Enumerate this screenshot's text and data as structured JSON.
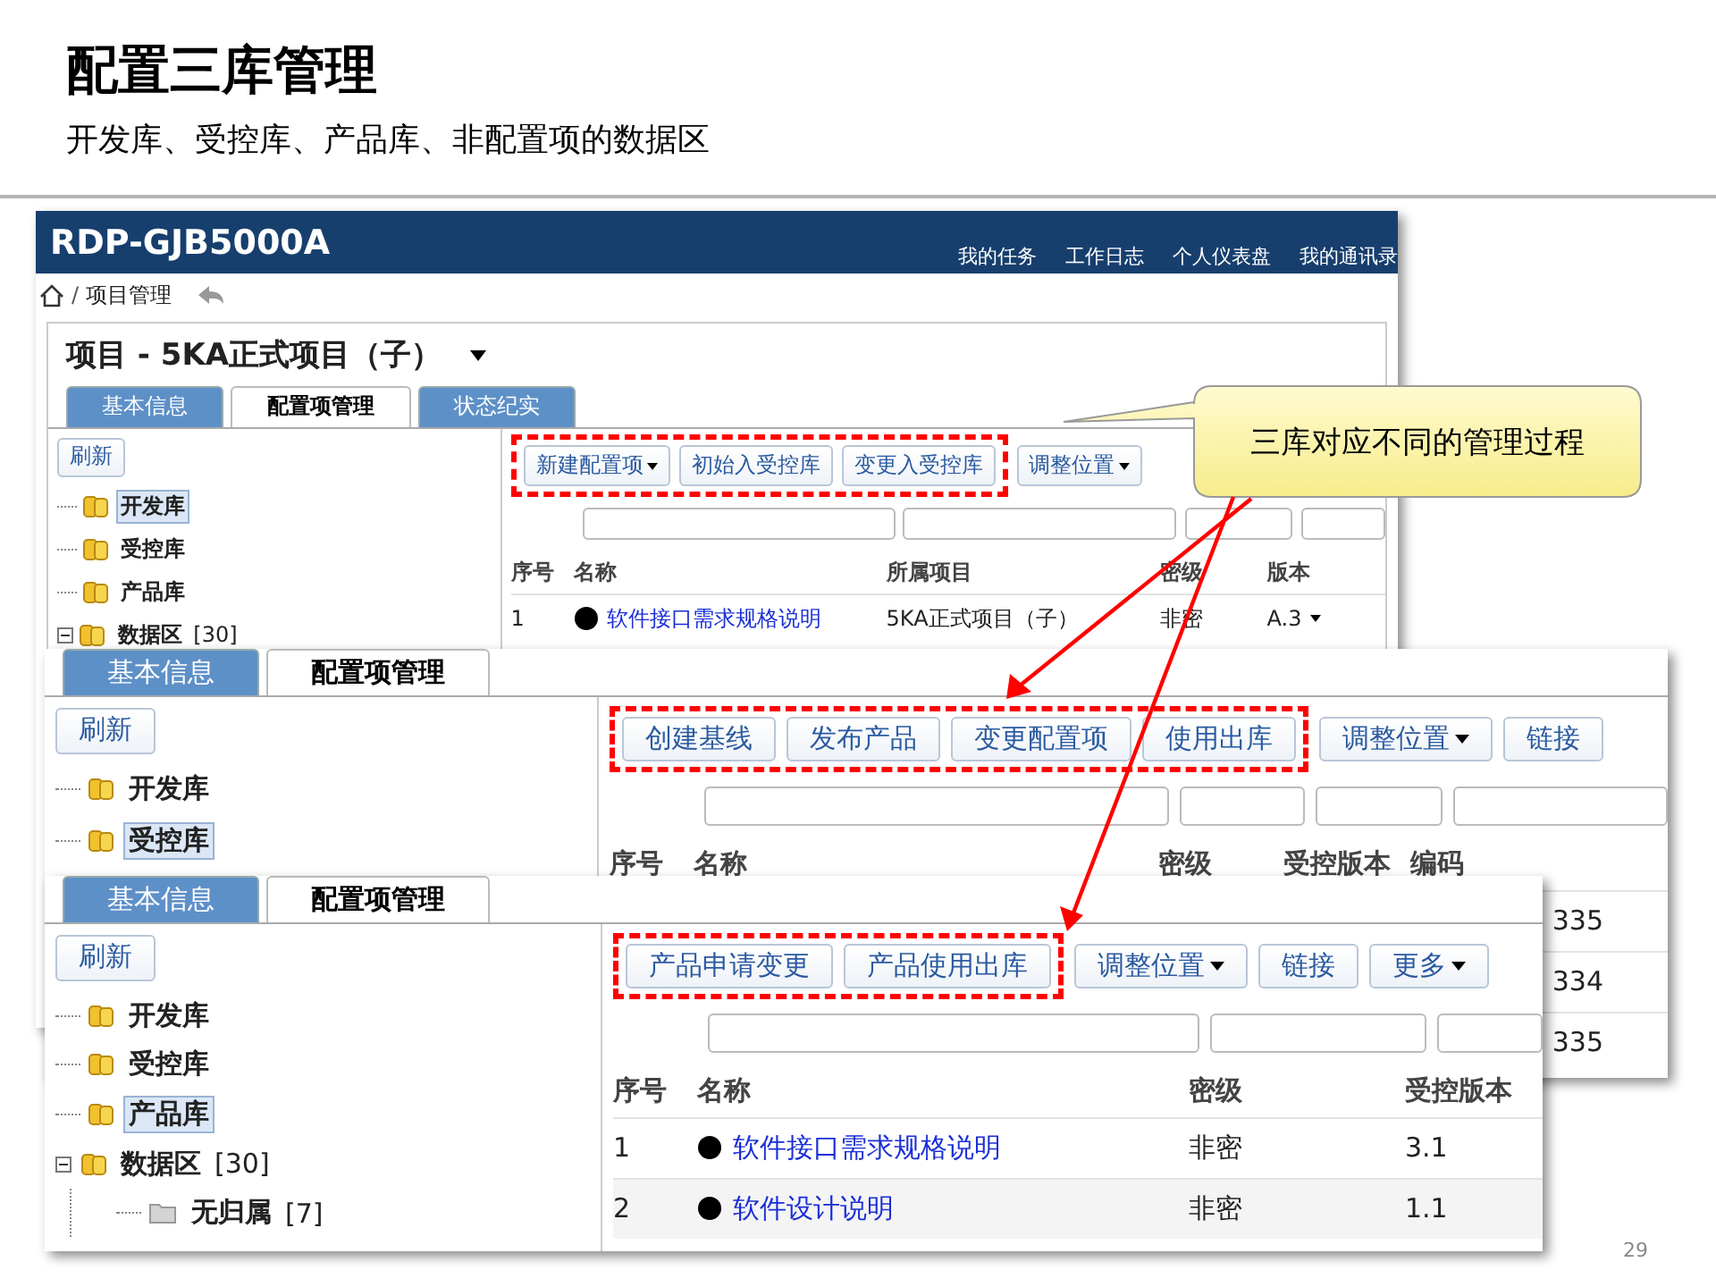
{
  "slide": {
    "title": "配置三库管理",
    "subtitle": "开发库、受控库、产品库、非配置项的数据区",
    "page_number": "29"
  },
  "callout": {
    "text": "三库对应不同的管理过程"
  },
  "panels": [
    {
      "app": {
        "name": "RDP-GJB5000A",
        "nav": [
          "我的任务",
          "工作日志",
          "个人仪表盘",
          "我的通讯录"
        ],
        "breadcrumb_separator": "/",
        "breadcrumb": "项目管理",
        "project_title": "项目 - 5KA正式项目（子）"
      },
      "tabs": [
        {
          "label": "基本信息",
          "selected": false
        },
        {
          "label": "配置项管理",
          "selected": true
        },
        {
          "label": "状态纪实",
          "selected": false
        }
      ],
      "tree": {
        "refresh": "刷新",
        "items": [
          {
            "kind": "library",
            "label": "开发库",
            "selected": true
          },
          {
            "kind": "library",
            "label": "受控库",
            "selected": false
          },
          {
            "kind": "library",
            "label": "产品库",
            "selected": false
          },
          {
            "kind": "library",
            "label": "数据区",
            "count": "[30]",
            "selected": false,
            "expanded": true
          }
        ]
      },
      "toolbar": [
        {
          "label": "新建配置项",
          "menu": true,
          "highlighted": true
        },
        {
          "label": "初始入受控库",
          "menu": false,
          "highlighted": true
        },
        {
          "label": "变更入受控库",
          "menu": false,
          "highlighted": true
        },
        {
          "label": "调整位置",
          "menu": true,
          "highlighted": false
        }
      ],
      "table": {
        "columns": [
          {
            "kind": "number",
            "label": "序号"
          },
          {
            "kind": "name",
            "label": "名称"
          },
          {
            "kind": "project",
            "label": "所属项目"
          },
          {
            "kind": "classification",
            "label": "密级"
          },
          {
            "kind": "version",
            "label": "版本"
          }
        ],
        "rows": [
          {
            "number": "1",
            "name": "软件接口需求规格说明",
            "project": "5KA正式项目（子）",
            "classification": "非密",
            "version": "A.3",
            "menu": true
          }
        ]
      }
    },
    {
      "tabs": [
        {
          "label": "基本信息",
          "selected": false
        },
        {
          "label": "配置项管理",
          "selected": true
        }
      ],
      "tree": {
        "refresh": "刷新",
        "items": [
          {
            "kind": "library",
            "label": "开发库",
            "selected": false
          },
          {
            "kind": "library",
            "label": "受控库",
            "selected": true
          }
        ]
      },
      "toolbar": [
        {
          "label": "创建基线",
          "menu": false,
          "highlighted": true
        },
        {
          "label": "发布产品",
          "menu": false,
          "highlighted": true
        },
        {
          "label": "变更配置项",
          "menu": false,
          "highlighted": true
        },
        {
          "label": "使用出库",
          "menu": false,
          "highlighted": true
        },
        {
          "label": "调整位置",
          "menu": true,
          "highlighted": false
        },
        {
          "label": "链接",
          "menu": false,
          "highlighted": false
        }
      ],
      "table": {
        "columns": [
          {
            "kind": "number",
            "label": "序号"
          },
          {
            "kind": "name",
            "label": "名称"
          },
          {
            "kind": "classification",
            "label": "密级"
          },
          {
            "kind": "version",
            "label": "受控版本"
          },
          {
            "kind": "code",
            "label": "编码"
          }
        ],
        "rows": [
          {
            "code": "335"
          },
          {
            "code": "334"
          },
          {
            "code": "335"
          }
        ]
      }
    },
    {
      "tabs": [
        {
          "label": "基本信息",
          "selected": false
        },
        {
          "label": "配置项管理",
          "selected": true
        }
      ],
      "tree": {
        "refresh": "刷新",
        "items": [
          {
            "kind": "library",
            "label": "开发库",
            "selected": false
          },
          {
            "kind": "library",
            "label": "受控库",
            "selected": false
          },
          {
            "kind": "library",
            "label": "产品库",
            "selected": true
          },
          {
            "kind": "library",
            "label": "数据区",
            "count": "[30]",
            "selected": false,
            "expanded": true,
            "children": [
              {
                "kind": "folder",
                "label": "无归属",
                "count": "[7]",
                "selected": false
              }
            ]
          }
        ]
      },
      "toolbar": [
        {
          "label": "产品申请变更",
          "menu": false,
          "highlighted": true
        },
        {
          "label": "产品使用出库",
          "menu": false,
          "highlighted": true
        },
        {
          "label": "调整位置",
          "menu": true,
          "highlighted": false
        },
        {
          "label": "链接",
          "menu": false,
          "highlighted": false
        },
        {
          "label": "更多",
          "menu": true,
          "highlighted": false
        }
      ],
      "table": {
        "columns": [
          {
            "kind": "number",
            "label": "序号"
          },
          {
            "kind": "name",
            "label": "名称"
          },
          {
            "kind": "classification",
            "label": "密级"
          },
          {
            "kind": "version",
            "label": "受控版本"
          }
        ],
        "rows": [
          {
            "number": "1",
            "name": "软件接口需求规格说明",
            "classification": "非密",
            "version": "3.1"
          },
          {
            "number": "2",
            "name": "软件设计说明",
            "classification": "非密",
            "version": "1.1"
          }
        ]
      }
    }
  ]
}
